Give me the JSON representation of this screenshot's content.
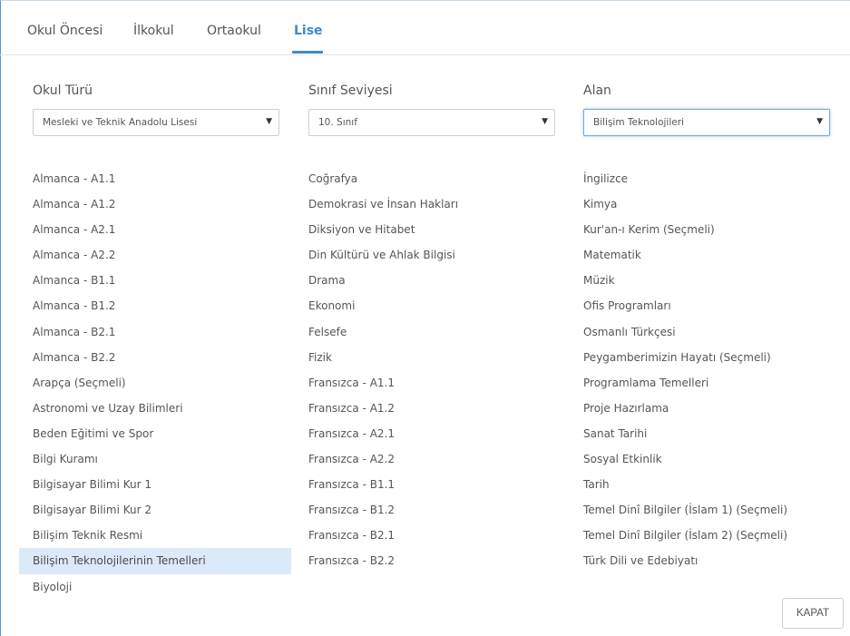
{
  "tabs": [
    {
      "label": "Okul Öncesi",
      "active": false
    },
    {
      "label": "İlkokul",
      "active": false
    },
    {
      "label": "Ortaokul",
      "active": false
    },
    {
      "label": "Lise",
      "active": true
    }
  ],
  "filters": {
    "school_type": {
      "label": "Okul Türü",
      "value": "Mesleki ve Teknik Anadolu Lisesi"
    },
    "grade_level": {
      "label": "Sınıf Seviyesi",
      "value": "10. Sınıf"
    },
    "field": {
      "label": "Alan",
      "value": "Bilişim Teknolojileri"
    }
  },
  "subjects": {
    "column_1": [
      "Almanca - A1.1",
      "Almanca - A1.2",
      "Almanca - A2.1",
      "Almanca - A2.2",
      "Almanca - B1.1",
      "Almanca - B1.2",
      "Almanca - B2.1",
      "Almanca - B2.2",
      "Arapça (Seçmeli)",
      "Astronomi ve Uzay Bilimleri",
      "Beden Eğitimi ve Spor",
      "Bilgi Kuramı",
      "Bilgisayar Bilimi Kur 1",
      "Bilgisayar Bilimi Kur 2",
      "Bilişim Teknik Resmi",
      "Bilişim Teknolojilerinin Temelleri",
      "Biyoloji"
    ],
    "column_2": [
      "Coğrafya",
      "Demokrasi ve İnsan Hakları",
      "Diksiyon ve Hitabet",
      "Din Kültürü ve Ahlak Bilgisi",
      "Drama",
      "Ekonomi",
      "Felsefe",
      "Fizik",
      "Fransızca - A1.1",
      "Fransızca - A1.2",
      "Fransızca - A2.1",
      "Fransızca - A2.2",
      "Fransızca - B1.1",
      "Fransızca - B1.2",
      "Fransızca - B2.1",
      "Fransızca - B2.2"
    ],
    "column_3": [
      "İngilizce",
      "Kimya",
      "Kur'an-ı Kerim (Seçmeli)",
      "Matematik",
      "Müzik",
      "Ofis Programları",
      "Osmanlı Türkçesi",
      "Peygamberimizin Hayatı (Seçmeli)",
      "Programlama Temelleri",
      "Proje Hazırlama",
      "Sanat Tarihi",
      "Sosyal Etkinlik",
      "Tarih",
      "Temel Dinî Bilgiler (İslam 1) (Seçmeli)",
      "Temel Dinî Bilgiler (İslam 2) (Seçmeli)",
      "Türk Dili ve Edebiyatı"
    ],
    "selected": "Bilişim Teknolojilerinin Temelleri"
  },
  "close_label": "KAPAT",
  "colors": {
    "accent": "#3f86d3",
    "selected_bg": "#dbeaf9"
  }
}
